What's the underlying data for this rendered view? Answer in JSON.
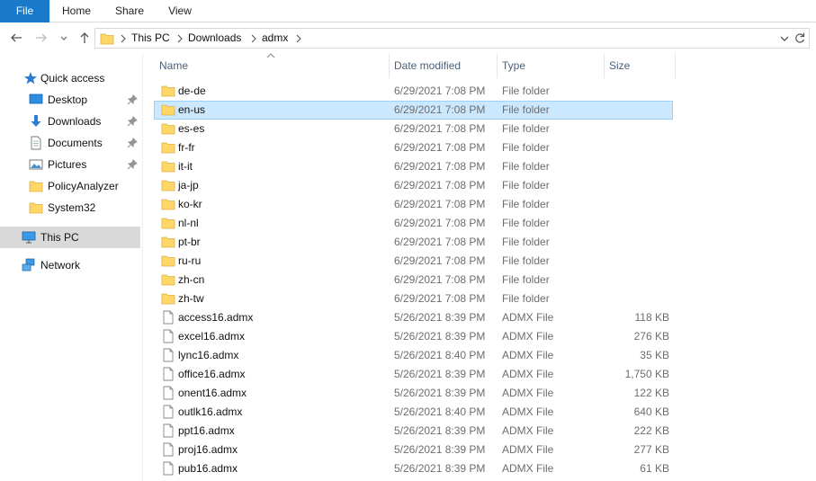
{
  "ribbon": {
    "tabs": [
      "File",
      "Home",
      "Share",
      "View"
    ]
  },
  "address": {
    "crumbs": [
      "This PC",
      "Downloads",
      "admx"
    ]
  },
  "navpane": {
    "items": [
      {
        "label": "Quick access",
        "icon": "star-icon"
      },
      {
        "label": "Desktop",
        "icon": "desktop-icon",
        "pinned": true
      },
      {
        "label": "Downloads",
        "icon": "download-arrow-icon",
        "pinned": true
      },
      {
        "label": "Documents",
        "icon": "documents-icon",
        "pinned": true
      },
      {
        "label": "Pictures",
        "icon": "pictures-icon",
        "pinned": true
      },
      {
        "label": "PolicyAnalyzer",
        "icon": "folder-icon"
      },
      {
        "label": "System32",
        "icon": "folder-icon"
      },
      {
        "label": "This PC",
        "icon": "computer-icon",
        "selected": true
      },
      {
        "label": "Network",
        "icon": "network-icon"
      }
    ]
  },
  "columns": {
    "name": "Name",
    "date": "Date modified",
    "type": "Type",
    "size": "Size"
  },
  "files": [
    {
      "name": "de-de",
      "date": "6/29/2021 7:08 PM",
      "type": "File folder",
      "size": "",
      "kind": "folder"
    },
    {
      "name": "en-us",
      "date": "6/29/2021 7:08 PM",
      "type": "File folder",
      "size": "",
      "kind": "folder",
      "selected": true
    },
    {
      "name": "es-es",
      "date": "6/29/2021 7:08 PM",
      "type": "File folder",
      "size": "",
      "kind": "folder"
    },
    {
      "name": "fr-fr",
      "date": "6/29/2021 7:08 PM",
      "type": "File folder",
      "size": "",
      "kind": "folder"
    },
    {
      "name": "it-it",
      "date": "6/29/2021 7:08 PM",
      "type": "File folder",
      "size": "",
      "kind": "folder"
    },
    {
      "name": "ja-jp",
      "date": "6/29/2021 7:08 PM",
      "type": "File folder",
      "size": "",
      "kind": "folder"
    },
    {
      "name": "ko-kr",
      "date": "6/29/2021 7:08 PM",
      "type": "File folder",
      "size": "",
      "kind": "folder"
    },
    {
      "name": "nl-nl",
      "date": "6/29/2021 7:08 PM",
      "type": "File folder",
      "size": "",
      "kind": "folder"
    },
    {
      "name": "pt-br",
      "date": "6/29/2021 7:08 PM",
      "type": "File folder",
      "size": "",
      "kind": "folder"
    },
    {
      "name": "ru-ru",
      "date": "6/29/2021 7:08 PM",
      "type": "File folder",
      "size": "",
      "kind": "folder"
    },
    {
      "name": "zh-cn",
      "date": "6/29/2021 7:08 PM",
      "type": "File folder",
      "size": "",
      "kind": "folder"
    },
    {
      "name": "zh-tw",
      "date": "6/29/2021 7:08 PM",
      "type": "File folder",
      "size": "",
      "kind": "folder"
    },
    {
      "name": "access16.admx",
      "date": "5/26/2021 8:39 PM",
      "type": "ADMX File",
      "size": "118 KB",
      "kind": "file"
    },
    {
      "name": "excel16.admx",
      "date": "5/26/2021 8:39 PM",
      "type": "ADMX File",
      "size": "276 KB",
      "kind": "file"
    },
    {
      "name": "lync16.admx",
      "date": "5/26/2021 8:40 PM",
      "type": "ADMX File",
      "size": "35 KB",
      "kind": "file"
    },
    {
      "name": "office16.admx",
      "date": "5/26/2021 8:39 PM",
      "type": "ADMX File",
      "size": "1,750 KB",
      "kind": "file"
    },
    {
      "name": "onent16.admx",
      "date": "5/26/2021 8:39 PM",
      "type": "ADMX File",
      "size": "122 KB",
      "kind": "file"
    },
    {
      "name": "outlk16.admx",
      "date": "5/26/2021 8:40 PM",
      "type": "ADMX File",
      "size": "640 KB",
      "kind": "file"
    },
    {
      "name": "ppt16.admx",
      "date": "5/26/2021 8:39 PM",
      "type": "ADMX File",
      "size": "222 KB",
      "kind": "file"
    },
    {
      "name": "proj16.admx",
      "date": "5/26/2021 8:39 PM",
      "type": "ADMX File",
      "size": "277 KB",
      "kind": "file"
    },
    {
      "name": "pub16.admx",
      "date": "5/26/2021 8:39 PM",
      "type": "ADMX File",
      "size": "61 KB",
      "kind": "file"
    }
  ],
  "colors": {
    "file_tab": "#1979ca",
    "selection_bg": "#cce8ff",
    "selection_border": "#99d1ff",
    "folder_yellow": "#ffd766",
    "nav_selected": "#d9d9d9"
  }
}
